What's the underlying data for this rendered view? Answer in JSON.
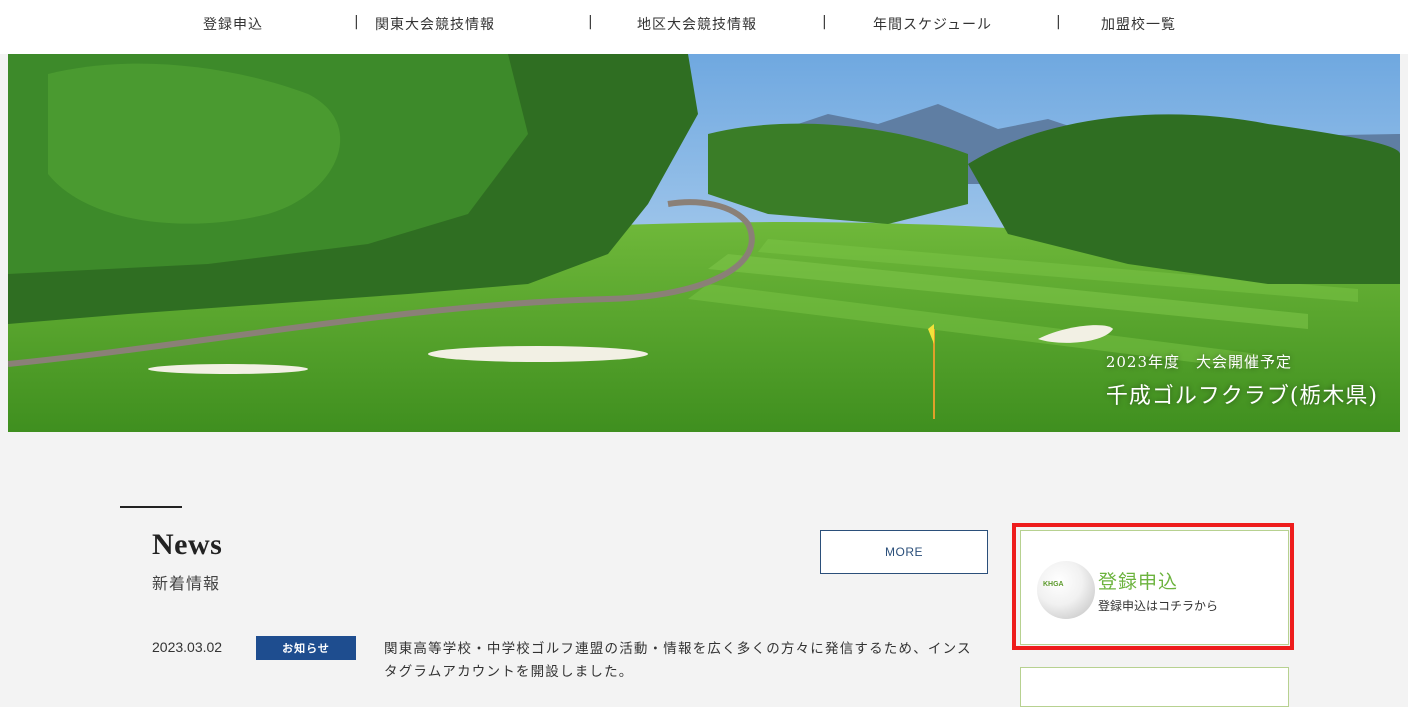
{
  "nav": {
    "items": [
      "登録申込",
      "関東大会競技情報",
      "地区大会競技情報",
      "年間スケジュール",
      "加盟校一覧"
    ],
    "separator": "|"
  },
  "hero": {
    "caption_sub": "2023年度　大会開催予定",
    "caption_main": "千成ゴルフクラブ(栃木県)"
  },
  "news": {
    "title": "News",
    "subtitle": "新着情報",
    "more_label": "MORE",
    "items": [
      {
        "date": "2023.03.02",
        "badge": "お知らせ",
        "text": "関東高等学校・中学校ゴルフ連盟の活動・情報を広く多くの方々に発信するため、インスタグラムアカウントを開設しました。"
      }
    ]
  },
  "register_card": {
    "logo_text": "KHGA",
    "title": "登録申込",
    "subtitle": "登録申込はコチラから"
  },
  "colors": {
    "badge": "#1e4d8f",
    "accent_green": "#6cb33e",
    "highlight_red": "#ee1c1c",
    "more_border": "#2b4f7a"
  }
}
